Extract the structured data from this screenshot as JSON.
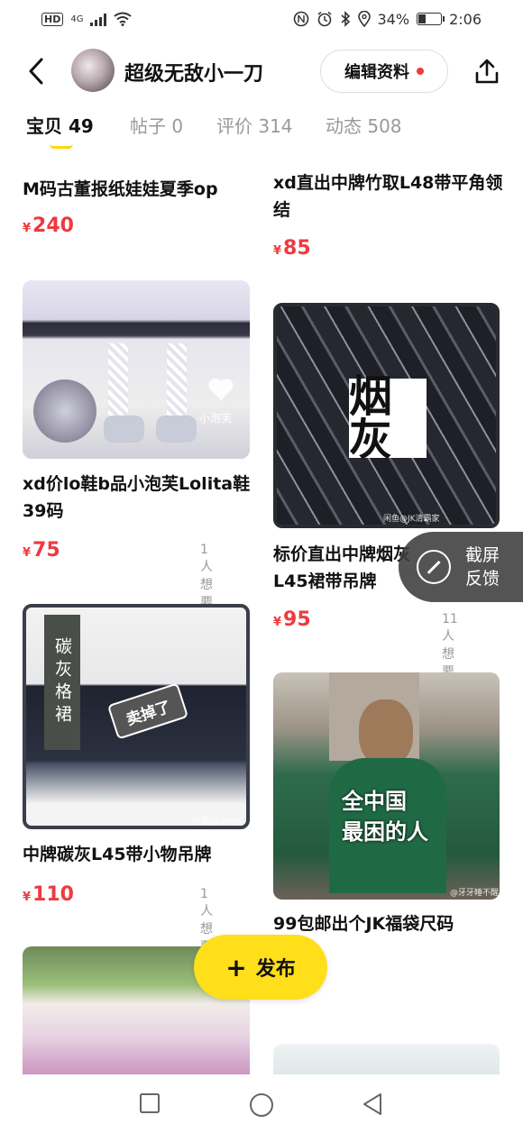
{
  "status_bar": {
    "hd": "HD",
    "network": "4G",
    "battery": "34%",
    "battery_level": 0.34,
    "time": "2:06"
  },
  "header": {
    "shop_name": "超级无敌小一刀",
    "edit_label": "编辑资料"
  },
  "tabs": [
    {
      "label": "宝贝 49",
      "active": true
    },
    {
      "label": "帖子 0",
      "active": false
    },
    {
      "label": "评价 314",
      "active": false
    },
    {
      "label": "动态 508",
      "active": false
    }
  ],
  "left_column": [
    {
      "title": "M码古董报纸娃娃夏季op",
      "price": "240",
      "wants": ""
    },
    {
      "title": "xd价lo鞋b品小泡芙Lolita鞋39码",
      "price": "75",
      "wants": "1人想要",
      "image_text": "小泡芙"
    },
    {
      "title": "中牌碳灰L45带小物吊牌",
      "price": "110",
      "wants": "1人想要",
      "image_vertical_text": "碳灰格裙",
      "image_sticker": "卖掉了",
      "image_watermark": "闲鱼@iipng_"
    },
    {
      "title": "",
      "price": "",
      "wants": ""
    }
  ],
  "right_column": [
    {
      "title": "xd直出中牌竹取L48带平角领结",
      "price": "85",
      "wants": ""
    },
    {
      "title": "标价直出中牌烟灰L45裙带吊牌",
      "price": "95",
      "wants": "11人想要",
      "image_text": "烟灰",
      "image_watermark": "闲鱼@JK清霸家"
    },
    {
      "title": "99包邮出个JK福袋尺码",
      "price": "",
      "wants": "",
      "image_text_line1": "全中国",
      "image_text_line2": "最困的人",
      "image_watermark": "@牙牙睡不醒"
    },
    {
      "title": "",
      "price": "",
      "wants": ""
    }
  ],
  "currency": "¥",
  "floating": {
    "screenshot_label_1": "截屏",
    "screenshot_label_2": "反馈",
    "publish_label": "发布"
  },
  "colors": {
    "price_red": "#f0393e",
    "accent_yellow": "#ffde1a",
    "notify_red": "#f13a3a"
  }
}
